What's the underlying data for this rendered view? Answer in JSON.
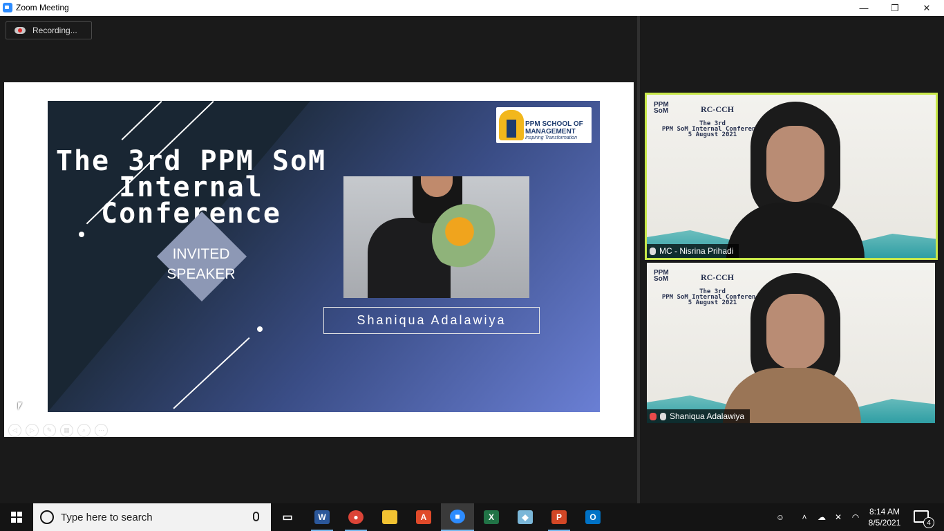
{
  "window": {
    "title": "Zoom Meeting",
    "minimize_glyph": "—",
    "maximize_glyph": "❐",
    "close_glyph": "✕"
  },
  "recording": {
    "label": "Recording..."
  },
  "slide": {
    "title_line1": "The 3rd PPM SoM",
    "title_line2": "Internal Conference",
    "badge_line1": "INVITED",
    "badge_line2": "SPEAKER",
    "speaker_name": "Shaniqua Adalawiya",
    "logo_line1": "PPM SCHOOL OF",
    "logo_line2": "MANAGEMENT",
    "logo_tagline": "Inspiring Transformation"
  },
  "slide_tools": [
    {
      "icon": "previous-slide-icon",
      "glyph": "◁"
    },
    {
      "icon": "next-slide-icon",
      "glyph": "▷"
    },
    {
      "icon": "pen-icon",
      "glyph": "✎"
    },
    {
      "icon": "grid-icon",
      "glyph": "▦"
    },
    {
      "icon": "zoom-icon",
      "glyph": "⌕"
    },
    {
      "icon": "more-icon",
      "glyph": "⋯"
    }
  ],
  "participants": [
    {
      "name": "MC - Nisrina Prihadi",
      "muted": false,
      "active_speaker": true
    },
    {
      "name": "Shaniqua Adalawiya",
      "muted": true,
      "active_speaker": false
    }
  ],
  "tile_background": {
    "rc_text": "RC-CCH",
    "conf_line1": "The 3rd",
    "conf_line2": "PPM SoM Internal Conference",
    "conf_line3": "5 August 2021"
  },
  "taskbar": {
    "search_placeholder": "Type here to search",
    "apps": [
      {
        "name": "task-view",
        "label": "▭"
      },
      {
        "name": "word",
        "label": "W",
        "color": "#2b579a"
      },
      {
        "name": "chrome",
        "label": "●",
        "color": "#db4437"
      },
      {
        "name": "file-explorer",
        "label": "▬",
        "color": "#f1c232"
      },
      {
        "name": "acrobat",
        "label": "A",
        "color": "#e04a2a"
      },
      {
        "name": "zoom",
        "label": "■",
        "color": "#2d8cff"
      },
      {
        "name": "excel",
        "label": "X",
        "color": "#217346"
      },
      {
        "name": "notes-app",
        "label": "◆",
        "color": "#7bb7d8"
      },
      {
        "name": "powerpoint",
        "label": "P",
        "color": "#d24726"
      },
      {
        "name": "outlook",
        "label": "O",
        "color": "#0072c6"
      }
    ],
    "time": "8:14 AM",
    "date": "8/5/2021",
    "notification_count": "4"
  },
  "colors": {
    "active_speaker_border": "#c8e84a",
    "zoom_blue": "#2d8cff"
  }
}
